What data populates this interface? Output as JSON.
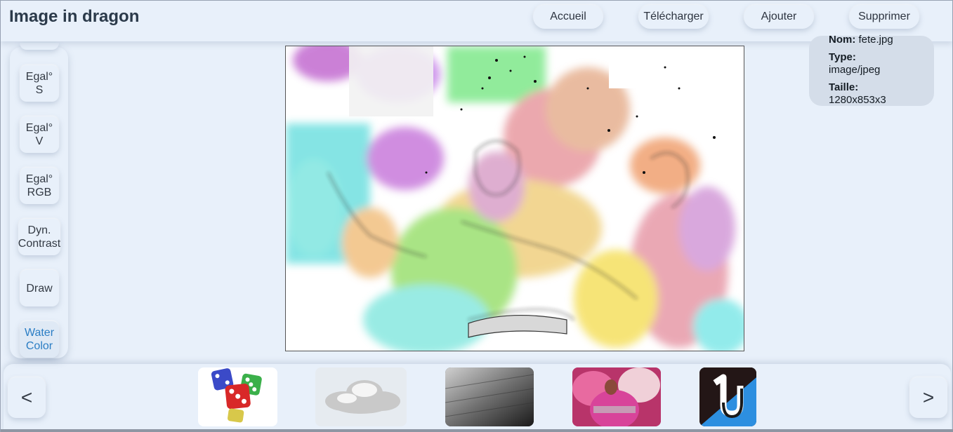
{
  "header": {
    "title": "Image in dragon",
    "nav": [
      {
        "label": "Accueil"
      },
      {
        "label": "Télécharger"
      },
      {
        "label": "Ajouter"
      },
      {
        "label": "Supprimer"
      }
    ]
  },
  "info": {
    "name_label": "Nom:",
    "name_value": "fete.jpg",
    "type_label": "Type:",
    "type_value": "image/jpeg",
    "size_label": "Taille:",
    "size_value": "1280x853x3"
  },
  "filters": [
    {
      "line1": "Egal°",
      "line2": "S"
    },
    {
      "line1": "Egal°",
      "line2": "V"
    },
    {
      "line1": "Egal°",
      "line2": "RGB"
    },
    {
      "line1": "Dyn.",
      "line2": "Contrast"
    },
    {
      "line1": "Draw",
      "line2": ""
    },
    {
      "line1": "Water",
      "line2": "Color",
      "active": true
    }
  ],
  "carousel": {
    "prev_label": "<",
    "next_label": ">",
    "thumbnails": [
      {
        "name": "dice-thumbnail"
      },
      {
        "name": "cloud-thumbnail"
      },
      {
        "name": "gray-texture-thumbnail"
      },
      {
        "name": "festival-thumbnail"
      },
      {
        "name": "logo-thumbnail"
      }
    ]
  },
  "colors": {
    "background": "#e8f0fa",
    "accent": "#2a7dc4",
    "info_panel": "#d4dde9"
  }
}
